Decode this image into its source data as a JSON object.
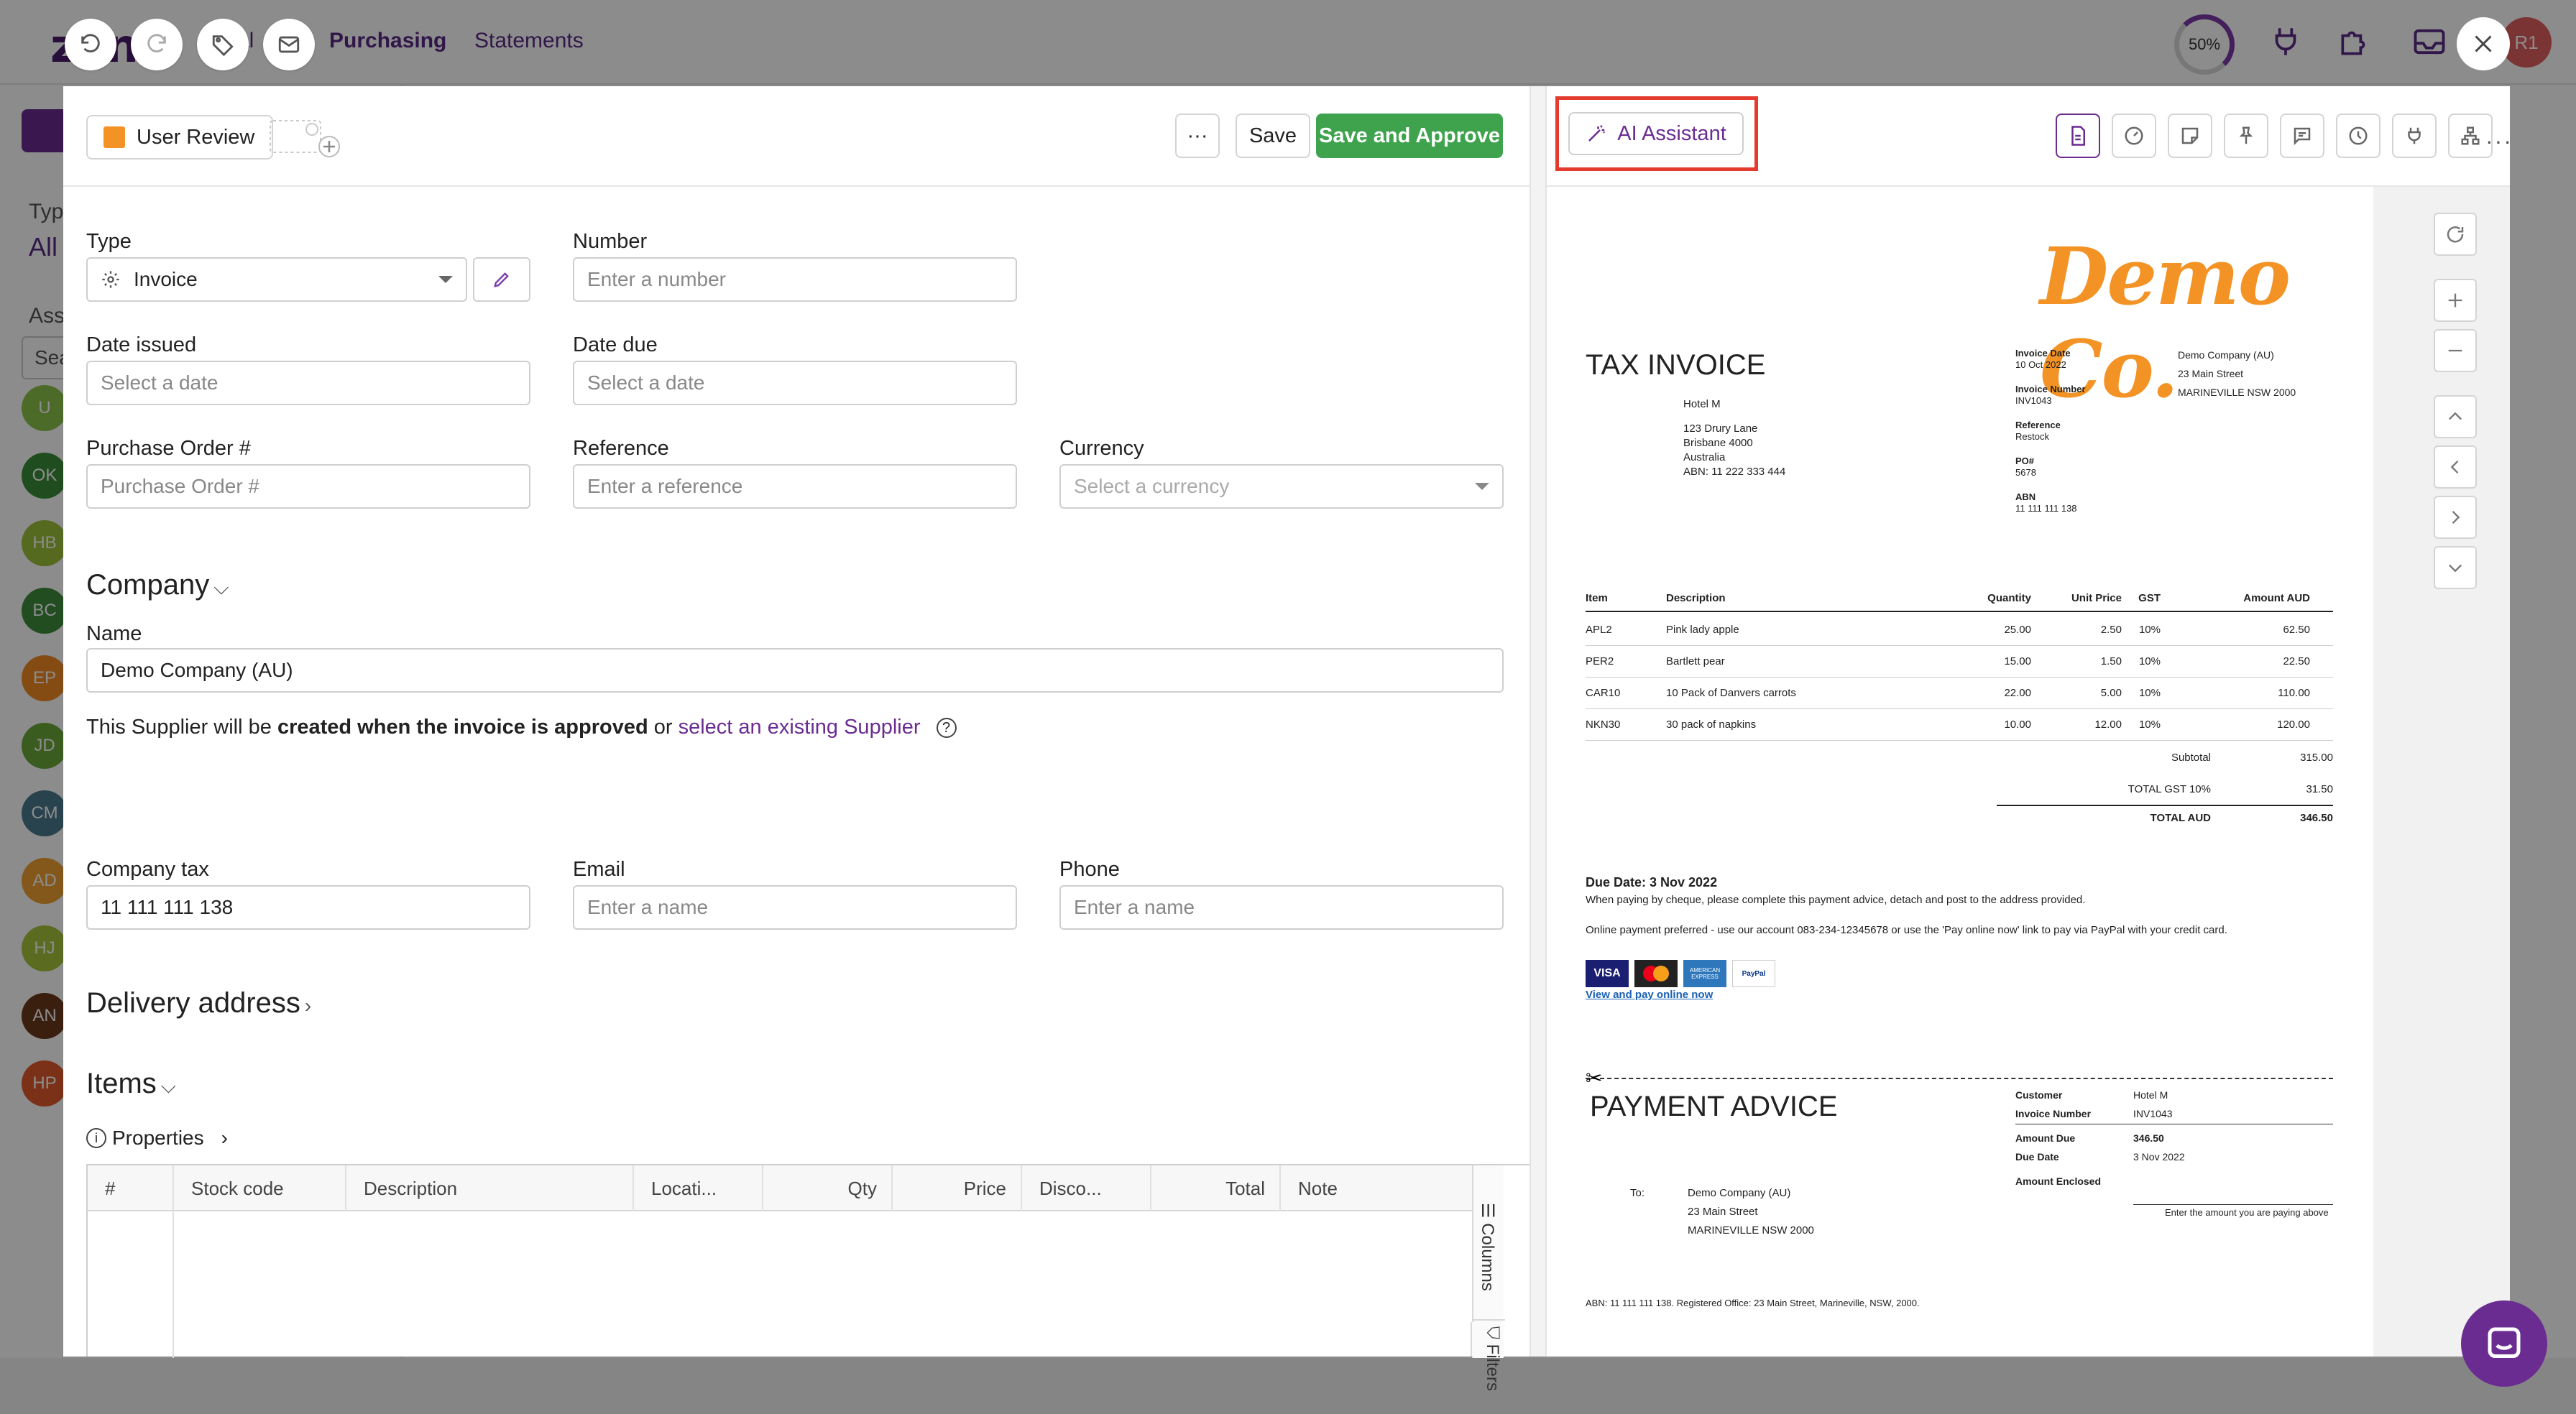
{
  "bg": {
    "logo": "zone",
    "nav_active": "Purchasing",
    "nav_statements": "Statements",
    "nav_partial": "al",
    "progress": "50%",
    "avatar_initials": "R1",
    "side_type_label": "Typ",
    "side_all": "All",
    "side_ass": "Ass",
    "side_search": "Sea",
    "avatars": [
      {
        "initials": "U",
        "color": "#8cc34a"
      },
      {
        "initials": "OK",
        "color": "#3a8d3a"
      },
      {
        "initials": "HB",
        "color": "#9bbf3a"
      },
      {
        "initials": "BC",
        "color": "#3c8d3c"
      },
      {
        "initials": "EP",
        "color": "#f08a24"
      },
      {
        "initials": "JD",
        "color": "#6aa83a"
      },
      {
        "initials": "CM",
        "color": "#4a7a8c"
      },
      {
        "initials": "AD",
        "color": "#f0a030"
      },
      {
        "initials": "HJ",
        "color": "#a6c43a"
      },
      {
        "initials": "AN",
        "color": "#6b3a1a"
      },
      {
        "initials": "HP",
        "color": "#e05a2a"
      }
    ]
  },
  "toolbar": {
    "status_label": "User Review",
    "more_label": "···",
    "save_label": "Save",
    "save_approve_label": "Save and Approve"
  },
  "form": {
    "type_label": "Type",
    "type_value": "Invoice",
    "number_label": "Number",
    "number_placeholder": "Enter a number",
    "date_issued_label": "Date issued",
    "date_issued_placeholder": "Select a date",
    "date_due_label": "Date due",
    "date_due_placeholder": "Select a date",
    "po_label": "Purchase Order #",
    "po_placeholder": "Purchase Order #",
    "reference_label": "Reference",
    "reference_placeholder": "Enter a reference",
    "currency_label": "Currency",
    "currency_placeholder": "Select a currency",
    "company_section": "Company",
    "name_label": "Name",
    "name_value": "Demo Company (AU)",
    "supplier_note_pre": "This Supplier will be ",
    "supplier_note_bold": "created when the invoice is approved",
    "supplier_note_or": " or ",
    "supplier_note_link": "select an existing Supplier",
    "company_tax_label": "Company tax",
    "company_tax_value": "11 111 111 138",
    "email_label": "Email",
    "email_placeholder": "Enter a name",
    "phone_label": "Phone",
    "phone_placeholder": "Enter a name",
    "delivery_section": "Delivery address",
    "items_section": "Items",
    "properties_label": "Properties",
    "columns": [
      "#",
      "Stock code",
      "Description",
      "Locati...",
      "Qty",
      "Price",
      "Disco...",
      "Total",
      "Note"
    ],
    "columns_tool": "Columns",
    "filters_tool": "Filters"
  },
  "assistant": {
    "label": "AI Assistant"
  },
  "invoice": {
    "logo": "Demo Co.",
    "title": "TAX INVOICE",
    "to_name": "Hotel M",
    "to_address": [
      "123 Drury Lane",
      "Brisbane 4000",
      "Australia",
      "ABN: 11 222 333 444"
    ],
    "meta": [
      {
        "label": "Invoice Date",
        "value": "10 Oct 2022"
      },
      {
        "label": "Invoice Number",
        "value": "INV1043"
      },
      {
        "label": "Reference",
        "value": "Restock"
      },
      {
        "label": "PO#",
        "value": "5678"
      },
      {
        "label": "ABN",
        "value": "11 111 111 138"
      }
    ],
    "from": [
      "Demo Company (AU)",
      "23 Main Street",
      "MARINEVILLE NSW 2000"
    ],
    "headers": [
      "Item",
      "Description",
      "Quantity",
      "Unit Price",
      "GST",
      "Amount AUD"
    ],
    "rows": [
      [
        "APL2",
        "Pink lady apple",
        "25.00",
        "2.50",
        "10%",
        "62.50"
      ],
      [
        "PER2",
        "Bartlett pear",
        "15.00",
        "1.50",
        "10%",
        "22.50"
      ],
      [
        "CAR10",
        "10 Pack of Danvers carrots",
        "22.00",
        "5.00",
        "10%",
        "110.00"
      ],
      [
        "NKN30",
        "30 pack of napkins",
        "10.00",
        "12.00",
        "10%",
        "120.00"
      ]
    ],
    "subtotal_label": "Subtotal",
    "subtotal": "315.00",
    "gst_label": "TOTAL  GST  10%",
    "gst": "31.50",
    "total_label": "TOTAL AUD",
    "total": "346.50",
    "due_date": "Due Date: 3 Nov 2022",
    "cheque_note": "When paying by cheque, please complete this payment advice, detach and post to the address provided.",
    "online_note": "Online payment preferred - use our account 083-234-12345678 or use the 'Pay online now' link to pay via PayPal with your credit card.",
    "pay_link": "View and pay online now",
    "card_visa": "VISA",
    "card_amex": "AMERICAN EXPRESS",
    "card_paypal": "PayPal",
    "advice_title": "PAYMENT ADVICE",
    "to_label": "To:",
    "advice_to": [
      "Demo Company (AU)",
      "23 Main Street",
      "MARINEVILLE NSW 2000"
    ],
    "advice_meta": [
      {
        "label": "Customer",
        "value": "Hotel M"
      },
      {
        "label": "Invoice Number",
        "value": "INV1043"
      },
      {
        "label": "Amount Due",
        "value": "346.50"
      },
      {
        "label": "Due Date",
        "value": "3 Nov 2022"
      },
      {
        "label": "Amount Enclosed",
        "value": ""
      }
    ],
    "enclosed_hint": "Enter the amount you are paying above",
    "footer": "ABN: 11 111 111 138.  Registered Office: 23 Main Street, Marineville, NSW, 2000."
  },
  "colors": {
    "brand": "#6a2c91",
    "green": "#3fa34d",
    "orange": "#f39325",
    "highlight": "#e33b2e"
  }
}
